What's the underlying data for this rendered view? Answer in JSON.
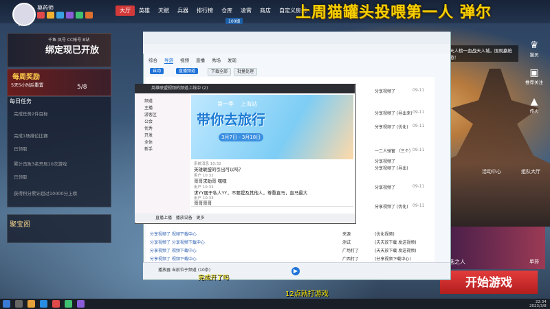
{
  "player": {
    "name": "莫药师",
    "level": "170"
  },
  "nav": {
    "tabs": [
      "大厅",
      "英雄",
      "天赋",
      "兵器",
      "排行榜",
      "仓库",
      "凌霄",
      "商店",
      "自定义房间"
    ],
    "active_tab": "大厅",
    "sub_badge": "100级"
  },
  "banner": {
    "text": "上周猫罐头投喂第一人",
    "suffix": "弹尔"
  },
  "left": {
    "promo_sub": "千鱼 凤号 CC帐号 B站",
    "promo_title": "绑定现已开放",
    "daily_reward": {
      "title": "每周奖励",
      "subtitle": "5天5小时后重置",
      "count": "5/8"
    },
    "daily_task_title": "每日任务",
    "tasks": [
      "完成任务2件目标",
      "完成1场排位比赛",
      "已领取",
      "累计击败3名开局10次游戏",
      "已领取",
      "获得积分累计超过10000分上榜"
    ],
    "treasure": "聚宝阁"
  },
  "right": {
    "notice": "天人榜一血战天人城，围观赢枪游！",
    "icons": [
      {
        "label": "猫灵",
        "glyph": "♛"
      },
      {
        "label": "推荐关注",
        "glyph": "▣"
      },
      {
        "label": "传火",
        "glyph": "▲"
      }
    ],
    "activity": "活动中心",
    "squad": "组队大厅",
    "char_left": "选之人",
    "char_right": "单排",
    "start_button": "开始游戏"
  },
  "cc": {
    "tabs": [
      "综合",
      "导游",
      "视频",
      "直播",
      "秀场",
      "发现"
    ],
    "active_tab": "导游",
    "buttons": [
      "自动",
      "直播频道"
    ],
    "light_buttons": [
      "下载全部",
      "批量处理"
    ],
    "rows": [
      {
        "title": "分享视频了",
        "col": "分享视频了",
        "time": "09-11"
      },
      {
        "title": "分享视频了 (导出来)",
        "col": "分享视频了",
        "time": "09-11"
      },
      {
        "title": "分享视频了 (优化)",
        "col": "分享视频了",
        "time": "09-11"
      },
      {
        "title": "一二人弹窗 （三个）",
        "col": "来源",
        "time": "09-11"
      },
      {
        "title": "分享视频了",
        "col": "分享视频了",
        "time": "09-11"
      },
      {
        "title": "分享视频了 (导出)",
        "col": "分享视频了",
        "time": "09-11"
      },
      {
        "title": "分享视频了",
        "col": "分享视频了",
        "time": "09-11"
      },
      {
        "title": "分享视频了 (优化)",
        "col": "分享视频了",
        "time": "09-11"
      }
    ],
    "bottom_rows": [
      {
        "title": "分享视频了 视频下载中心",
        "col": "来源",
        "right": "(优化视频)"
      },
      {
        "title": "分享视频了 分享视频下载中心",
        "col": "测试",
        "right": "(天天放下载 发送视频)"
      },
      {
        "title": "分享视频了 视频下载中心",
        "col": "广场打了",
        "right": "(天天放下载 发送视频)"
      },
      {
        "title": "分享视频了 视频下载中心",
        "col": "广西打了",
        "right": "(分享视频下载中心)"
      }
    ],
    "footer_text": "播放器 当前位于频道 (10条)"
  },
  "chat": {
    "title": "英雄联盟视频的频道上线中 (2)",
    "users": [
      "频道",
      "主播",
      "游客区",
      "公会",
      "优秀",
      "开发",
      "全体",
      "新手"
    ],
    "promo": {
      "season": "第一季",
      "location": "上海站",
      "title": "带你去旅行",
      "date": "3月7日 - 3月18日"
    },
    "messages": [
      {
        "meta": "系统消息 10:32",
        "text": "英雄联盟的引出可以吗？"
      },
      {
        "meta": "用户 10:32",
        "text": "哥哥求助哥 嘿嘿"
      },
      {
        "meta": "用户 10:33",
        "text": "求YY属于私人YY，不要提及其他人，尊重直马，直马最大"
      },
      {
        "meta": "用户 10:33",
        "text": "哥哥哥哥"
      }
    ],
    "bottom_labels": [
      "直播上播",
      "播放设备",
      "更多"
    ]
  },
  "subtitles": {
    "line1": "完成开了吗",
    "line2": "12点就打游戏"
  },
  "taskbar": {
    "time": "22:34",
    "date": "2023/3/8"
  }
}
